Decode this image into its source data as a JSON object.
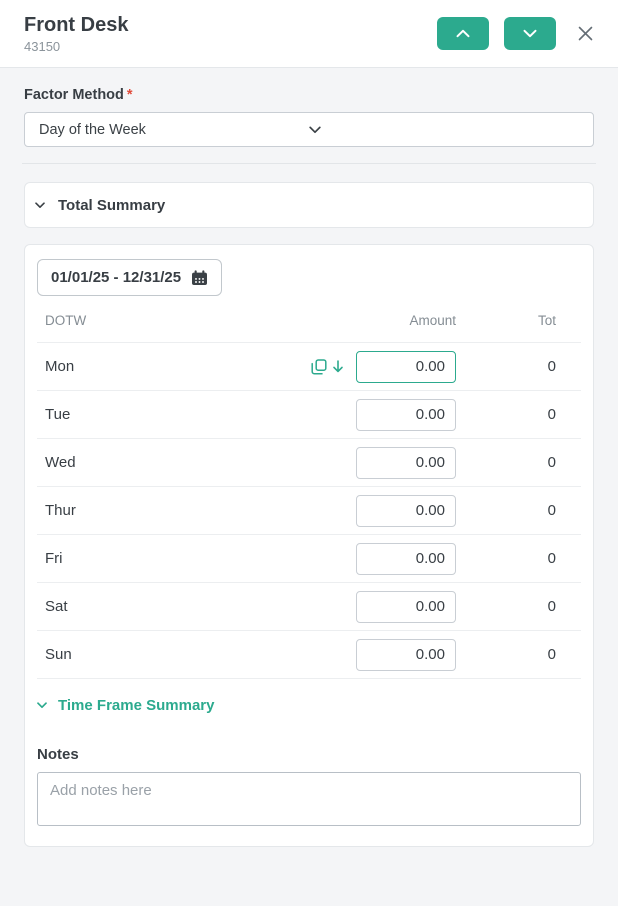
{
  "header": {
    "title": "Front Desk",
    "subtitle": "43150"
  },
  "factor_method": {
    "label": "Factor Method",
    "required_marker": "*",
    "selected_value": "Day of the Week"
  },
  "total_summary": {
    "label": "Total Summary"
  },
  "summary_card": {
    "date_range": "01/01/25 - 12/31/25",
    "table": {
      "headers": {
        "dotw": "DOTW",
        "amount": "Amount",
        "tot": "Tot"
      },
      "rows": [
        {
          "day": "Mon",
          "amount": "0.00",
          "tot": "0",
          "has_copy_icons": true,
          "focused": true
        },
        {
          "day": "Tue",
          "amount": "0.00",
          "tot": "0",
          "has_copy_icons": false,
          "focused": false
        },
        {
          "day": "Wed",
          "amount": "0.00",
          "tot": "0",
          "has_copy_icons": false,
          "focused": false
        },
        {
          "day": "Thur",
          "amount": "0.00",
          "tot": "0",
          "has_copy_icons": false,
          "focused": false
        },
        {
          "day": "Fri",
          "amount": "0.00",
          "tot": "0",
          "has_copy_icons": false,
          "focused": false
        },
        {
          "day": "Sat",
          "amount": "0.00",
          "tot": "0",
          "has_copy_icons": false,
          "focused": false
        },
        {
          "day": "Sun",
          "amount": "0.00",
          "tot": "0",
          "has_copy_icons": false,
          "focused": false
        }
      ]
    },
    "time_frame_summary_label": "Time Frame Summary",
    "notes": {
      "label": "Notes",
      "placeholder": "Add notes here"
    }
  },
  "icons": {
    "previous": "chevron-up-icon",
    "next": "chevron-down-icon",
    "close": "close-icon",
    "select": "chevron-down-icon",
    "date": "calendar-icon",
    "row_actions": [
      "copy-icon",
      "arrow-down-icon"
    ]
  },
  "colors": {
    "accent_teal": "#2caa8e",
    "text_dark": "#3b4146",
    "text_gray": "#858d94",
    "border_input": "#c9ced4",
    "border_card": "#e4e7ea",
    "background": "#f4f5f7",
    "required_red": "#e04a3a"
  }
}
